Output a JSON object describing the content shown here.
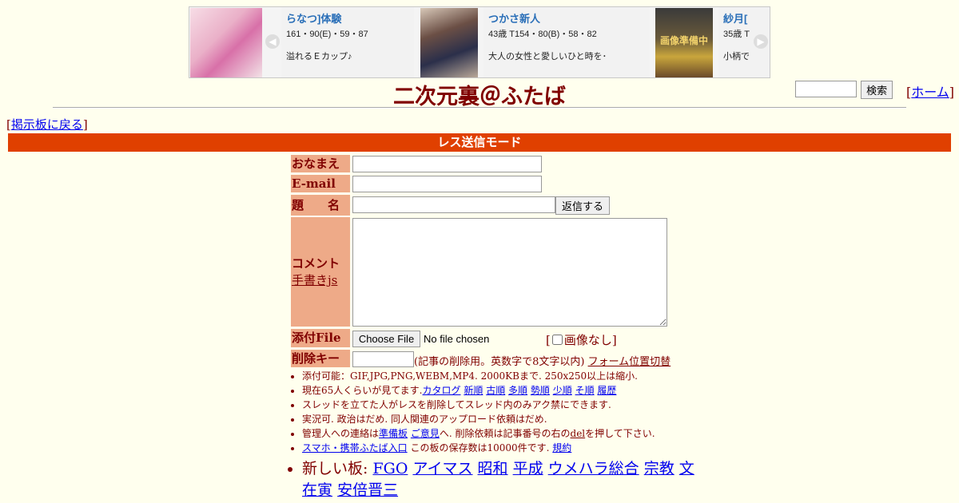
{
  "ads": [
    {
      "name": "らなつ]体験",
      "meta": "161・90(E)・59・87",
      "catch": "溢れるＥカップ♪"
    },
    {
      "name": "つかさ新人",
      "meta": "43歳 T154・80(B)・58・82",
      "catch": "大人の女性と愛しいひと時を･"
    },
    {
      "name": "紗月[",
      "meta": "35歳 T",
      "catch": "小柄で"
    }
  ],
  "ad_badge": "画像準備中",
  "site_title": "二次元裏＠ふたば",
  "search": {
    "button": "検索"
  },
  "home_link": "ホーム",
  "back_link": "掲示板に戻る",
  "mode_bar": "レス送信モード",
  "form": {
    "name_label": "おなまえ",
    "email_label": "E-mail",
    "subject_label": "題　　名",
    "submit_label": "返信する",
    "comment_label": "コメント",
    "tegaki_link": "手書きjs",
    "file_label": "添付File",
    "file_button": "Choose File",
    "file_status": "No file chosen",
    "noimg_label": "画像なし",
    "delkey_label": "削除キー",
    "delkey_note": "(記事の削除用。英数字で8文字以内)",
    "form_toggle": "フォーム位置切替"
  },
  "notes": {
    "n1": "添付可能：GIF,JPG,PNG,WEBM,MP4. 2000KBまで. 250x250以上は縮小.",
    "n2_prefix": "現在65人くらいが見てます.",
    "n2_links": [
      "カタログ",
      "新順",
      "古順",
      "多順",
      "勢順",
      "少順",
      "そ順",
      "履歴"
    ],
    "n3": "スレッドを立てた人がレスを削除してスレッド内のみアク禁にできます.",
    "n4": "実況可. 政治はだめ. 同人関連のアップロード依頼はだめ.",
    "n5_a": "管理人への連絡は",
    "n5_link1": "準備板",
    "n5_link2": "ご意見",
    "n5_b": "へ. 削除依頼は記事番号の右の",
    "n5_del": "del",
    "n5_c": "を押して下さい.",
    "n6_link": "スマホ・携帯ふたば入口",
    "n6_text": " この板の保存数は10000件です.",
    "n6_rule": "規約",
    "n7_prefix": "新しい板: ",
    "n7_links": [
      "FGO",
      "アイマス",
      "昭和",
      "平成",
      "ウメハラ総合",
      "宗教",
      "文在寅",
      "安倍晋三"
    ]
  }
}
